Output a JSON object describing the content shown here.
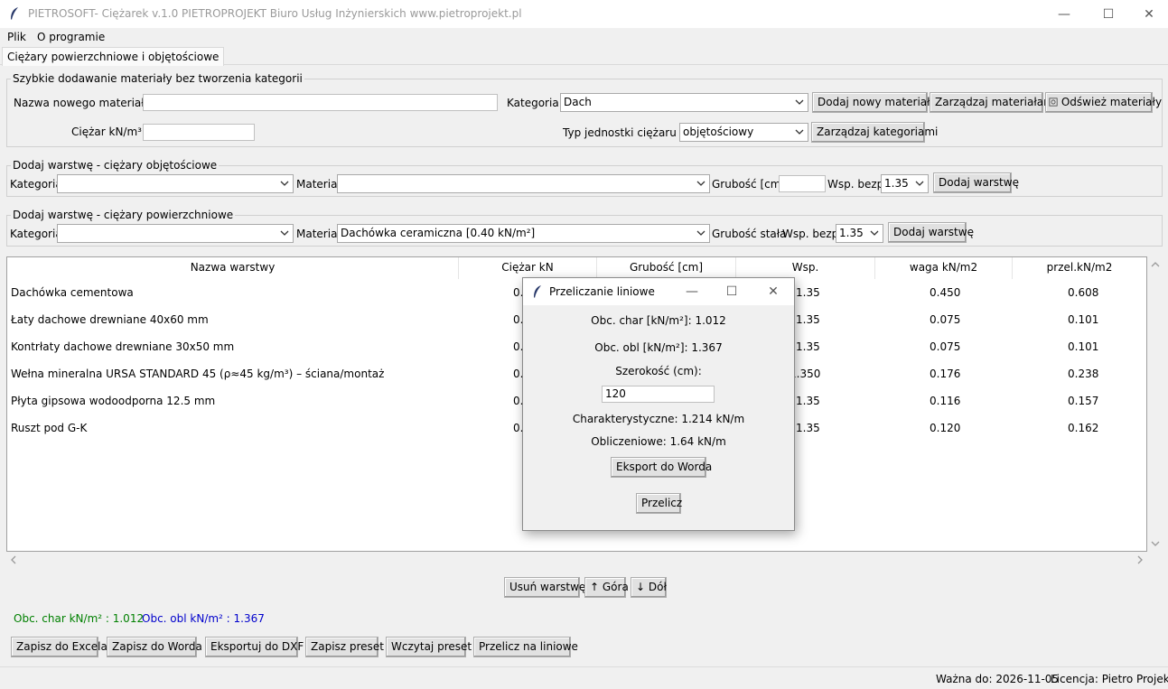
{
  "window": {
    "title": "PIETROSOFT- Ciężarek v.1.0 PIETROPROJEKT Biuro Usług Inżynierskich www.pietroprojekt.pl",
    "minimize": "—",
    "maximize": "☐",
    "close": "✕"
  },
  "menu": {
    "file": "Plik",
    "about": "O programie"
  },
  "tab": {
    "label": "Ciężary powierzchniowe i objętościowe"
  },
  "quick_add": {
    "group_title": "Szybkie dodawanie materiały bez tworzenia kategorii",
    "name_label": "Nazwa nowego materiału",
    "name_value": "",
    "weight_label": "Ciężar kN/m³",
    "weight_value": "",
    "category_label": "Kategoria",
    "category_value": "Dach",
    "unit_type_label": "Typ jednostki ciężaru",
    "unit_type_value": "objętościowy",
    "add_material_btn": "Dodaj nowy materiał",
    "manage_materials_btn": "Zarządzaj materiałami",
    "refresh_materials_btn": "Odśwież materiały",
    "manage_categories_btn": "Zarządzaj kategoriami"
  },
  "volume_layer": {
    "group_title": "Dodaj warstwę - ciężary objętościowe",
    "category_label": "Kategoria",
    "category_value": "",
    "material_label": "Materiał",
    "material_value": "",
    "thickness_label": "Grubość [cm]",
    "thickness_value": "",
    "factor_label": "Wsp. bezp.",
    "factor_value": "1.35",
    "add_btn": "Dodaj warstwę"
  },
  "surface_layer": {
    "group_title": "Dodaj warstwę - ciężary powierzchniowe",
    "category_label": "Kategoria",
    "category_value": "",
    "material_label": "Materiał",
    "material_value": "Dachówka ceramiczna  [0.40 kN/m²]",
    "thickness_label": "Grubość  stała",
    "factor_label": "Wsp. bezp.",
    "factor_value": "1.35",
    "add_btn": "Dodaj warstwę"
  },
  "table": {
    "columns": [
      "Nazwa warstwy",
      "Ciężar kN",
      "Grubość [cm]",
      "Wsp.",
      "waga kN/m2",
      "przel.kN/m2"
    ],
    "rows": [
      {
        "name": "Dachówka cementowa",
        "weight": "0.",
        "factor": "1.35",
        "mass": "0.450",
        "calc": "0.608"
      },
      {
        "name": "Łaty dachowe drewniane 40x60 mm",
        "weight": "0.",
        "factor": "1.35",
        "mass": "0.075",
        "calc": "0.101"
      },
      {
        "name": "Kontrłaty dachowe drewniane 30x50 mm",
        "weight": "0.",
        "factor": "1.35",
        "mass": "0.075",
        "calc": "0.101"
      },
      {
        "name": "Wełna mineralna URSA STANDARD 45 (ρ≈45 kg/m³) – ściana/montaż",
        "weight": "0.",
        "factor": "1.350",
        "mass": "0.176",
        "calc": "0.238"
      },
      {
        "name": "Płyta gipsowa wodoodporna 12.5 mm",
        "weight": "0.",
        "factor": "1.35",
        "mass": "0.116",
        "calc": "0.157"
      },
      {
        "name": "Ruszt pod G-K",
        "weight": "0.",
        "factor": "1.35",
        "mass": "0.120",
        "calc": "0.162"
      }
    ]
  },
  "row_controls": {
    "remove": "Usuń warstwę",
    "up": "↑ Góra",
    "down": "↓ Dół"
  },
  "summary": {
    "char": "Obc. char kN/m² : 1.012",
    "obl": "Obc. obl kN/m² : 1.367",
    "char_color": "#008000",
    "obl_color": "#0000cc"
  },
  "actions": {
    "excel": "Zapisz do Excela",
    "word": "Zapisz do Worda",
    "dxf": "Eksportuj do DXF",
    "save_preset": "Zapisz preset",
    "load_preset": "Wczytaj preset",
    "linear": "Przelicz na liniowe"
  },
  "status": {
    "valid": "Ważna do: 2026-11-05",
    "license": "Licencja: Pietro Projekt"
  },
  "dialog": {
    "title": "Przeliczanie liniowe",
    "minimize": "—",
    "maximize": "☐",
    "close": "✕",
    "char_line": "Obc. char [kN/m²]: 1.012",
    "obl_line": "Obc. obl  [kN/m²]: 1.367",
    "width_label": "Szerokość (cm):",
    "width_value": "120",
    "result_char": "Charakterystyczne: 1.214 kN/m",
    "result_obl": "Obliczeniowe: 1.64 kN/m",
    "export_btn": "Eksport do Worda",
    "recalc_btn": "Przelicz"
  }
}
